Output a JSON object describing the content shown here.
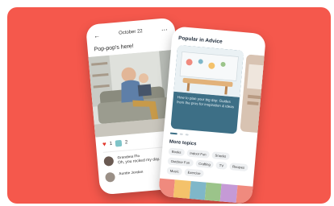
{
  "colors": {
    "background": "#f5584c",
    "accent": "#3d6f86",
    "heart": "#e23a2e"
  },
  "left_phone": {
    "header": {
      "back_icon": "back-arrow-icon",
      "date": "October 22",
      "menu_icon": "more-icon"
    },
    "post_caption": "Pop-pop's here!",
    "reactions": {
      "heart_count": "1",
      "comment_count": "2"
    },
    "comments": [
      {
        "author": "Grandma Flo",
        "text": "Oh, you rocked my day."
      },
      {
        "author": "Auntie Jordan",
        "text": ""
      }
    ]
  },
  "right_phone": {
    "section_title": "Popular in Advice",
    "hero_card_text": "How to plan your big day: Guides from the pros for inspiration & ideas",
    "more_topics_title": "More topics",
    "topics": [
      "Books",
      "Indoor Fun",
      "Snacks",
      "Outdoor Fun",
      "Crafting",
      "TV",
      "Recipes",
      "Music",
      "Exercise"
    ]
  }
}
